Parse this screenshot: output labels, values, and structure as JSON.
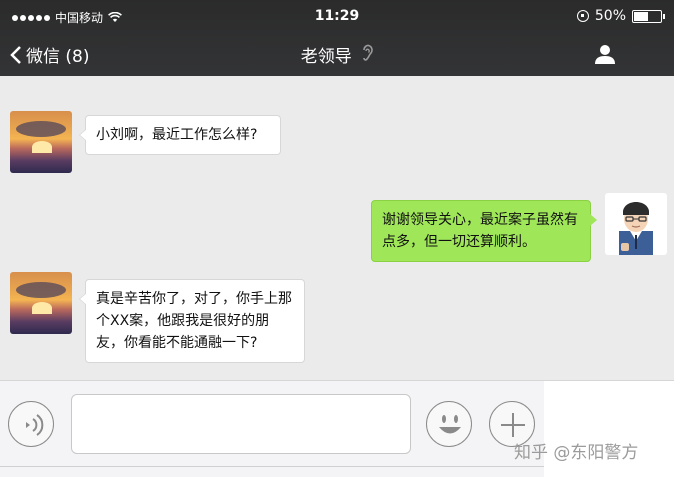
{
  "status_bar": {
    "carrier": "中国移动",
    "time": "11:29",
    "battery_text": "50%",
    "battery_level": 0.5
  },
  "header": {
    "back_label": "微信 (8)",
    "title": "老领导"
  },
  "messages": [
    {
      "side": "in",
      "text": "小刘啊，最近工作怎么样?"
    },
    {
      "side": "out",
      "text": "谢谢领导关心，最近案子虽然有点多，但一切还算顺利。"
    },
    {
      "side": "in",
      "text": "真是辛苦你了，对了，你手上那个XX案，他跟我是很好的朋友，你看能不能通融一下?"
    }
  ],
  "icons": {
    "back": "chevron-left-icon",
    "ear": "ear-icon",
    "contact": "person-icon",
    "voice": "voice-icon",
    "emoji": "smiley-icon",
    "more": "plus-icon"
  },
  "watermark": "知乎 @东阳警方",
  "colors": {
    "header_bg": "#2f3032",
    "chat_bg": "#ebebeb",
    "outgoing_bubble": "#9fe659",
    "incoming_bubble": "#ffffff"
  }
}
